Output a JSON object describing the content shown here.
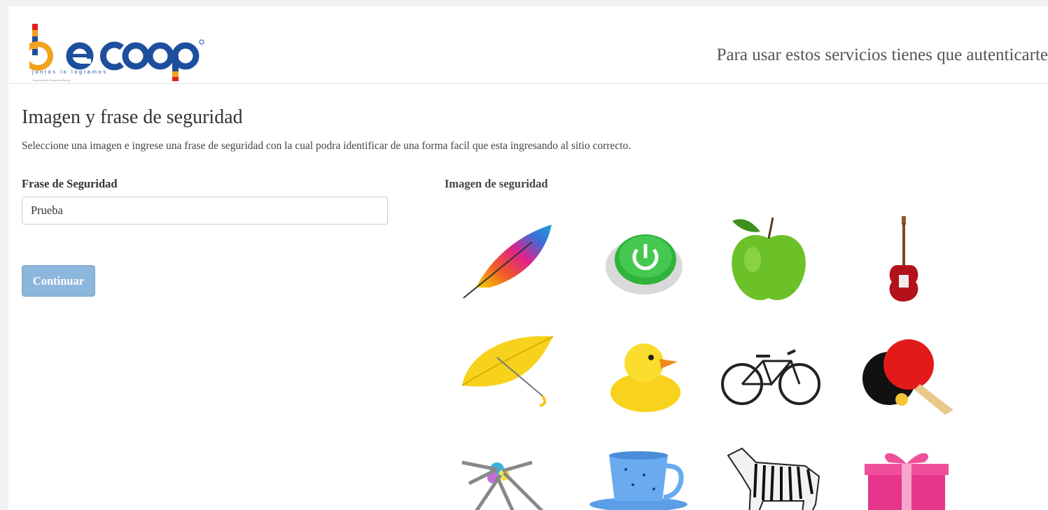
{
  "header": {
    "logo_text": "becoop",
    "logo_tagline": "juntos lo logramos",
    "logo_small": "Cooperativa de Empleados Becoop",
    "auth_message": "Para usar estos servicios tienes que autenticarte"
  },
  "main": {
    "title": "Imagen y frase de seguridad",
    "description": "Seleccione una imagen e ingrese una frase de seguridad con la cual podra identificar de una forma facil que esta ingresando al sitio correcto.",
    "phrase_label": "Frase de Seguridad",
    "phrase_value": "Prueba",
    "continue_label": "Continuar",
    "image_label": "Imagen de seguridad"
  },
  "security_images": [
    "feather",
    "power-button",
    "apple",
    "guitar",
    "umbrella",
    "rubber-duck",
    "bicycle",
    "ping-pong-paddle",
    "keys",
    "teacup",
    "zebra",
    "gift-box"
  ],
  "colors": {
    "button": "#8db6dc",
    "logo_blue": "#1d4f9e",
    "logo_orange": "#f2a21b",
    "logo_red": "#e2231a"
  }
}
